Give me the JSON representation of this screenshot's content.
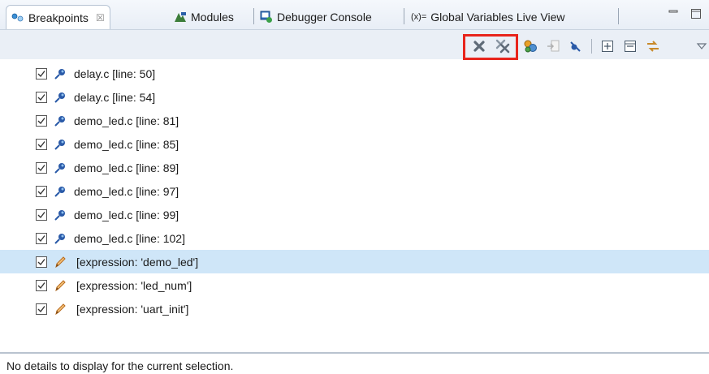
{
  "tabs": [
    {
      "label": "Breakpoints",
      "icon": "breakpoints-icon",
      "active": true,
      "close": "☒"
    },
    {
      "label": "Modules",
      "icon": "modules-icon",
      "active": false
    },
    {
      "label": "Debugger Console",
      "icon": "debugger-console-icon",
      "active": false
    },
    {
      "label": "Global Variables Live View",
      "icon_text": "(x)=",
      "icon": "variables-icon",
      "active": false
    }
  ],
  "toolbar": {
    "buttons": [
      "remove-selected-breakpoints",
      "remove-all-breakpoints",
      "show-breakpoints-supported-by-target",
      "go-to-file",
      "skip-all-breakpoints",
      "expand-all",
      "collapse-all",
      "link-with-debug-view",
      "view-menu"
    ],
    "highlight_color": "#e8241c"
  },
  "breakpoints": [
    {
      "label": "delay.c [line: 50]",
      "type": "line",
      "checked": true
    },
    {
      "label": "delay.c [line: 54]",
      "type": "line",
      "checked": true
    },
    {
      "label": "demo_led.c [line: 81]",
      "type": "line",
      "checked": true
    },
    {
      "label": "demo_led.c [line: 85]",
      "type": "line",
      "checked": true
    },
    {
      "label": "demo_led.c [line: 89]",
      "type": "line",
      "checked": true
    },
    {
      "label": "demo_led.c [line: 97]",
      "type": "line",
      "checked": true
    },
    {
      "label": "demo_led.c [line: 99]",
      "type": "line",
      "checked": true
    },
    {
      "label": "demo_led.c [line: 102]",
      "type": "line",
      "checked": true
    },
    {
      "label": "[expression: 'demo_led']",
      "type": "expression",
      "checked": true,
      "selected": true
    },
    {
      "label": "[expression: 'led_num']",
      "type": "expression",
      "checked": true
    },
    {
      "label": "[expression: 'uart_init']",
      "type": "expression",
      "checked": true
    }
  ],
  "details": {
    "text": "No details to display for the current selection."
  },
  "colors": {
    "selection": "#cfe6f8",
    "toolbar_bg": "#eaeff6"
  }
}
